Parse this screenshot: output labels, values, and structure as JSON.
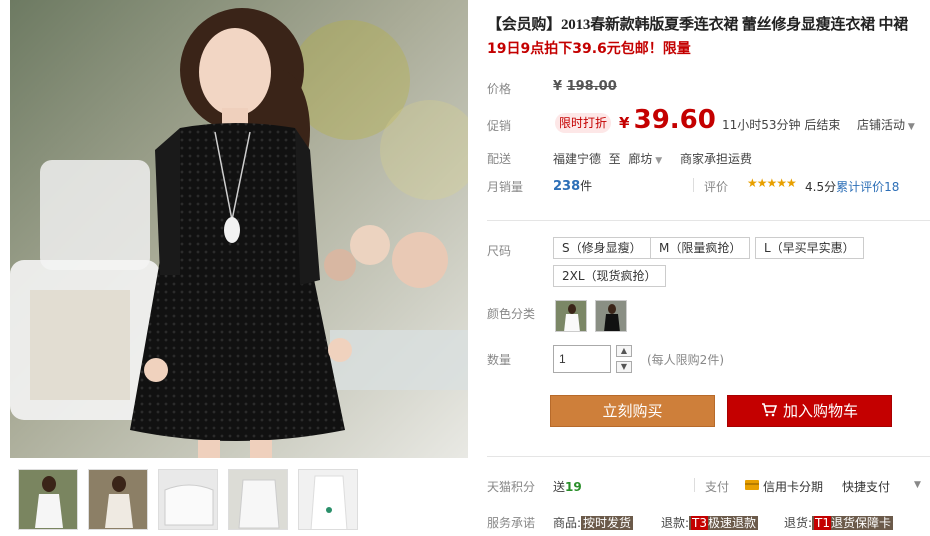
{
  "product": {
    "title": "【会员购】2013春新款韩版夏季连衣裙 蕾丝修身显瘦连衣裙 中裙",
    "subtitle": "19日9点拍下39.6元包邮！限量"
  },
  "labels": {
    "price": "价格",
    "promo": "促销",
    "delivery": "配送",
    "monthly_sales": "月销量",
    "size": "尺码",
    "color": "颜色分类",
    "quantity": "数量",
    "points": "天猫积分",
    "service": "服务承诺"
  },
  "price": {
    "currency": "¥",
    "original": "198.00",
    "promo_badge": "限时打折",
    "promo": "39.60",
    "countdown": "11小时53分钟 后结束",
    "shop_activity": "店铺活动"
  },
  "delivery": {
    "from": "福建宁德",
    "to_word": "至",
    "to": "廊坊",
    "note": "商家承担运费"
  },
  "sales": {
    "count": "238",
    "unit": "件",
    "rating_label": "评价",
    "rating_score": "4.5分",
    "rating_link": "累计评价18"
  },
  "sizes": [
    "S（修身显瘦）",
    "M（限量疯抢）",
    "L（早买早实惠）",
    "2XL（现货疯抢）"
  ],
  "quantity": {
    "value": "1",
    "limit_note": "(每人限购2件)"
  },
  "buttons": {
    "buy_now": "立刻购买",
    "add_cart": "加入购物车"
  },
  "points": {
    "prefix": "送",
    "value": "19"
  },
  "payment": {
    "label": "支付",
    "installment": "信用卡分期",
    "fastpay": "快捷支付"
  },
  "service": {
    "goods_label": "商品:",
    "goods_tag": "按时发货",
    "refund_label": "退款:",
    "refund_t": "T3",
    "refund_tag": "极速退款",
    "return_label": "退货:",
    "return_t": "T1",
    "return_tag": "退货保障卡"
  },
  "colors": {
    "accent_red": "#c40000",
    "buy_orange": "#ce7f3a",
    "link_blue": "#2d6fb7"
  }
}
